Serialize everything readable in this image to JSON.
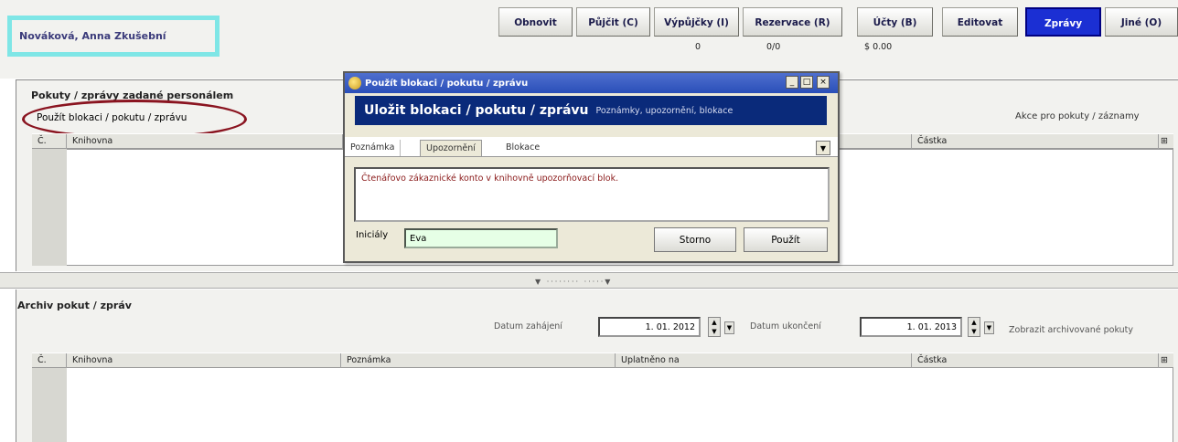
{
  "patron": {
    "name": "Nováková, Anna Zkušební"
  },
  "toolbar": {
    "buttons": [
      {
        "label": "Obnovit"
      },
      {
        "label": "Půjčit (C)"
      },
      {
        "label": "Výpůjčky (I)",
        "count": "0"
      },
      {
        "label": "Rezervace (R)",
        "count": "0/0"
      },
      {
        "label": "Účty (B)",
        "count": "$ 0.00"
      },
      {
        "label": "Editovat"
      },
      {
        "label": "Zprávy"
      },
      {
        "label": "Jiné (O)"
      }
    ]
  },
  "fines_section": {
    "title": "Pokuty / zprávy zadané personálem",
    "apply_link": "Použít blokaci / pokutu / zprávu",
    "actions_label": "Akce pro pokuty / záznamy",
    "columns": [
      "Č.",
      "Knihovna",
      "",
      "Částka"
    ]
  },
  "archive_section": {
    "title": "Archiv pokut / zpráv",
    "start_label": "Datum zahájení",
    "start_value": "1. 01. 2012",
    "end_label": "Datum ukončení",
    "end_value": "1. 01. 2013",
    "show_archived": "Zobrazit archivované pokuty",
    "columns": [
      "Č.",
      "Knihovna",
      "Poznámka",
      "Uplatněno na",
      "Částka"
    ]
  },
  "dialog": {
    "title": "Použít blokaci / pokutu / zprávu",
    "heading": "Uložit blokaci / pokutu / zprávu",
    "subheading": "Poznámky, upozornění, blokace",
    "tabs": [
      "Poznámka",
      "Upozornění",
      "Blokace"
    ],
    "active_tab": 1,
    "note_text": "Čtenářovo zákaznické konto v knihovně upozorňovací blok.",
    "initials_label": "Iniciály",
    "initials_value": "Eva",
    "cancel_label": "Storno",
    "apply_label": "Použít",
    "minimize": "_",
    "maximize": "□",
    "close": "×"
  },
  "colors": {
    "toolbar_active": "#1b2fd3",
    "patron_highlight": "#7fe6e6",
    "annotation_ellipse": "#8a1420",
    "dialog_header": "#0a2a7a",
    "titlebar": "#2a4fb8"
  }
}
